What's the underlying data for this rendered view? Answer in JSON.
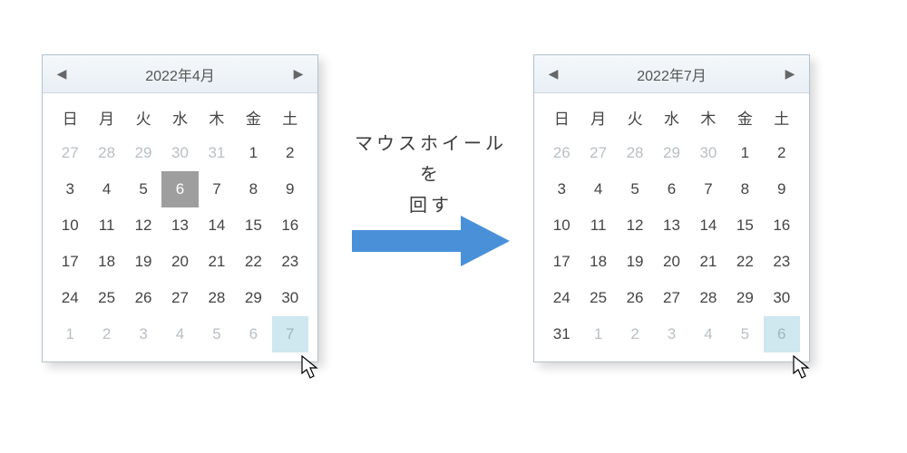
{
  "caption_line1": "マウスホイールを",
  "caption_line2": "回す",
  "dow": [
    "日",
    "月",
    "火",
    "水",
    "木",
    "金",
    "土"
  ],
  "colors": {
    "accent": "#4a90d9"
  },
  "calendars": [
    {
      "id": "left",
      "title": "2022年4月",
      "hover_index": 41,
      "selected_index": 10,
      "days": [
        {
          "n": 27,
          "muted": true
        },
        {
          "n": 28,
          "muted": true
        },
        {
          "n": 29,
          "muted": true
        },
        {
          "n": 30,
          "muted": true
        },
        {
          "n": 31,
          "muted": true
        },
        {
          "n": 1
        },
        {
          "n": 2
        },
        {
          "n": 3
        },
        {
          "n": 4
        },
        {
          "n": 5
        },
        {
          "n": 6
        },
        {
          "n": 7
        },
        {
          "n": 8
        },
        {
          "n": 9
        },
        {
          "n": 10
        },
        {
          "n": 11
        },
        {
          "n": 12
        },
        {
          "n": 13
        },
        {
          "n": 14
        },
        {
          "n": 15
        },
        {
          "n": 16
        },
        {
          "n": 17
        },
        {
          "n": 18
        },
        {
          "n": 19
        },
        {
          "n": 20
        },
        {
          "n": 21
        },
        {
          "n": 22
        },
        {
          "n": 23
        },
        {
          "n": 24
        },
        {
          "n": 25
        },
        {
          "n": 26
        },
        {
          "n": 27
        },
        {
          "n": 28
        },
        {
          "n": 29
        },
        {
          "n": 30
        },
        {
          "n": 1,
          "muted": true
        },
        {
          "n": 2,
          "muted": true
        },
        {
          "n": 3,
          "muted": true
        },
        {
          "n": 4,
          "muted": true
        },
        {
          "n": 5,
          "muted": true
        },
        {
          "n": 6,
          "muted": true
        },
        {
          "n": 7,
          "muted": true
        }
      ]
    },
    {
      "id": "right",
      "title": "2022年7月",
      "hover_index": 41,
      "selected_index": -1,
      "days": [
        {
          "n": 26,
          "muted": true
        },
        {
          "n": 27,
          "muted": true
        },
        {
          "n": 28,
          "muted": true
        },
        {
          "n": 29,
          "muted": true
        },
        {
          "n": 30,
          "muted": true
        },
        {
          "n": 1
        },
        {
          "n": 2
        },
        {
          "n": 3
        },
        {
          "n": 4
        },
        {
          "n": 5
        },
        {
          "n": 6
        },
        {
          "n": 7
        },
        {
          "n": 8
        },
        {
          "n": 9
        },
        {
          "n": 10
        },
        {
          "n": 11
        },
        {
          "n": 12
        },
        {
          "n": 13
        },
        {
          "n": 14
        },
        {
          "n": 15
        },
        {
          "n": 16
        },
        {
          "n": 17
        },
        {
          "n": 18
        },
        {
          "n": 19
        },
        {
          "n": 20
        },
        {
          "n": 21
        },
        {
          "n": 22
        },
        {
          "n": 23
        },
        {
          "n": 24
        },
        {
          "n": 25
        },
        {
          "n": 26
        },
        {
          "n": 27
        },
        {
          "n": 28
        },
        {
          "n": 29
        },
        {
          "n": 30
        },
        {
          "n": 31
        },
        {
          "n": 1,
          "muted": true
        },
        {
          "n": 2,
          "muted": true
        },
        {
          "n": 3,
          "muted": true
        },
        {
          "n": 4,
          "muted": true
        },
        {
          "n": 5,
          "muted": true
        },
        {
          "n": 6,
          "muted": true
        }
      ]
    }
  ]
}
